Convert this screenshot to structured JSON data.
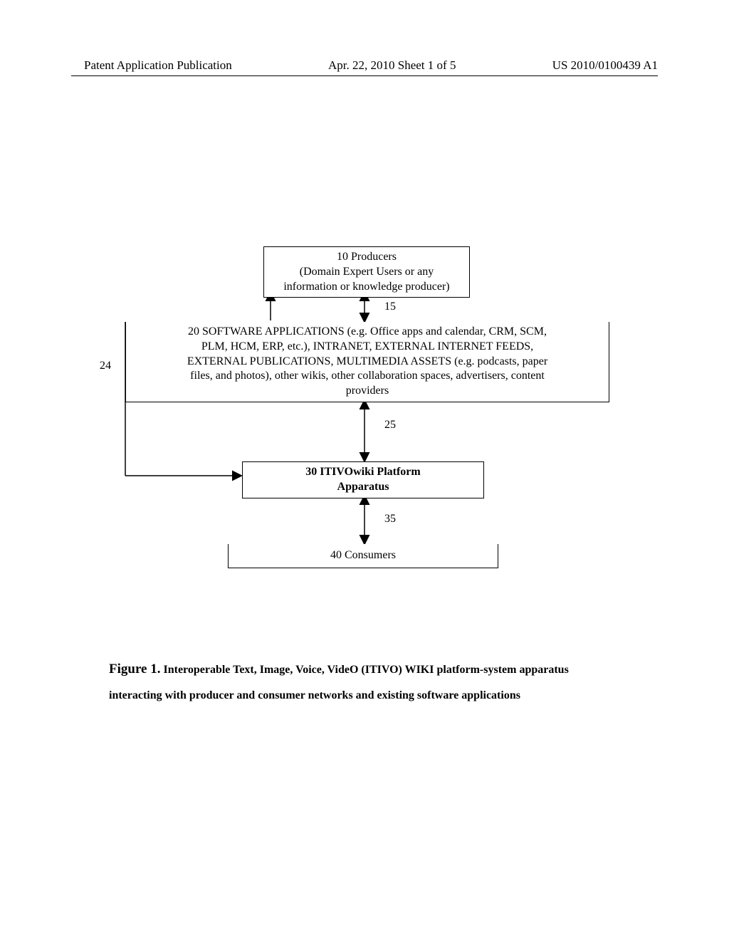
{
  "header": {
    "left": "Patent Application Publication",
    "center": "Apr. 22, 2010  Sheet 1 of 5",
    "right": "US 2010/0100439 A1"
  },
  "labels": {
    "n24": "24",
    "n15": "15",
    "n25": "25",
    "n35": "35"
  },
  "boxes": {
    "producers_line1": "10 Producers",
    "producers_line2": "(Domain Expert Users or any",
    "producers_line3": "information or knowledge producer)",
    "apps_line1": "20 SOFTWARE APPLICATIONS (e.g. Office apps and calendar, CRM, SCM,",
    "apps_line2": "PLM, HCM, ERP, etc.), INTRANET, EXTERNAL INTERNET FEEDS,",
    "apps_line3": "EXTERNAL PUBLICATIONS, MULTIMEDIA ASSETS (e.g. podcasts, paper",
    "apps_line4": "files, and photos), other wikis, other collaboration spaces, advertisers, content",
    "apps_line5": "providers",
    "platform_line1": "30 ITIVOwiki Platform",
    "platform_line2": "Apparatus",
    "consumers": "40 Consumers"
  },
  "caption": {
    "prefix": "Figure 1.",
    "text": " Interoperable Text, Image, Voice, VideO (ITIVO) WIKI platform-system apparatus interacting with producer and consumer networks and existing software applications"
  }
}
